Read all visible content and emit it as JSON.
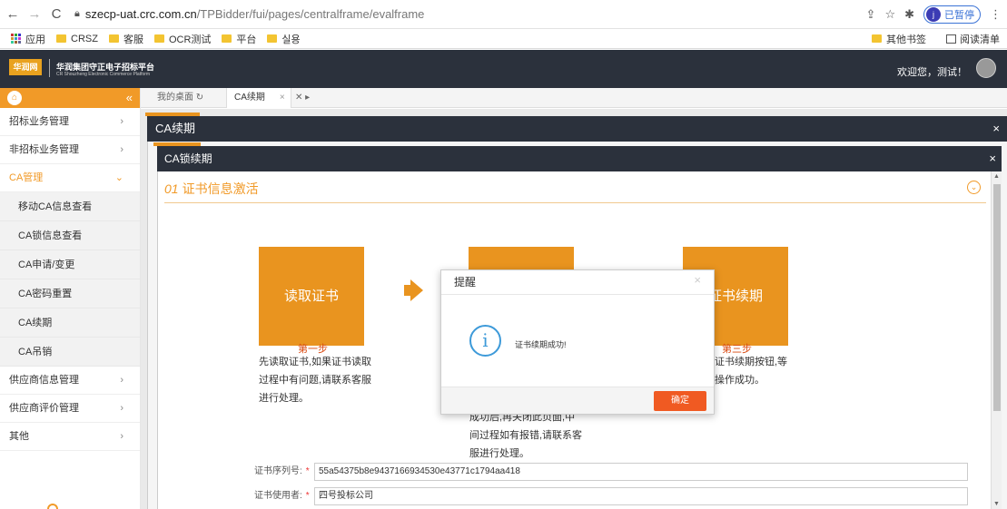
{
  "browser": {
    "url_host": "szecp-uat.crc.com.cn",
    "url_path": "/TPBidder/fui/pages/centralframe/evalframe",
    "profile_initial": "j",
    "profile_status": "已暂停"
  },
  "bookmarks": {
    "items": [
      "应用",
      "CRSZ",
      "客服",
      "OCR测试",
      "平台",
      "실용"
    ],
    "right": [
      "其他书签",
      "阅读清单"
    ]
  },
  "header": {
    "logo_mark": "华润网",
    "logo_title": "华润集团守正电子招标平台",
    "logo_subtitle": "CR Shouzheng Electronic Commerce Platform",
    "welcome": "欢迎您，测试！"
  },
  "sidebar": {
    "items": [
      {
        "label": "招标业务管理"
      },
      {
        "label": "非招标业务管理"
      },
      {
        "label": "CA管理"
      },
      {
        "label": "供应商信息管理"
      },
      {
        "label": "供应商评价管理"
      },
      {
        "label": "其他"
      }
    ],
    "sub_items": [
      "移动CA信息查看",
      "CA锁信息查看",
      "CA申请/变更",
      "CA密码重置",
      "CA续期",
      "CA吊销"
    ]
  },
  "tabs": [
    {
      "label": "我的桌面"
    },
    {
      "label": "CA续期"
    }
  ],
  "outer_modal": {
    "title": "CA续期"
  },
  "inner_modal": {
    "title": "CA锁续期"
  },
  "section": {
    "num": "01",
    "title": "证书信息激活"
  },
  "steps": [
    {
      "button": "读取证书",
      "label": "第一步",
      "desc": [
        "先读取证书,如果证书读取",
        "过程中有问题,请联系客服",
        "进行处理。"
      ]
    },
    {
      "button": "",
      "label": "",
      "desc": [
        "成功后,再关闭此页面,中",
        "间过程如有报错,请联系客",
        "服进行处理。"
      ]
    },
    {
      "button": "证书续期",
      "label": "第三步",
      "desc": [
        "证书续期按钮,等",
        "操作成功。"
      ]
    }
  ],
  "fields": {
    "serial_label": "证书序列号:",
    "serial_value": "55a54375b8e9437166934530e43771c1794aa418",
    "user_label": "证书使用者:",
    "user_value": "四号投标公司"
  },
  "dialog": {
    "title": "提醒",
    "message": "证书续期成功!",
    "ok": "确定"
  }
}
